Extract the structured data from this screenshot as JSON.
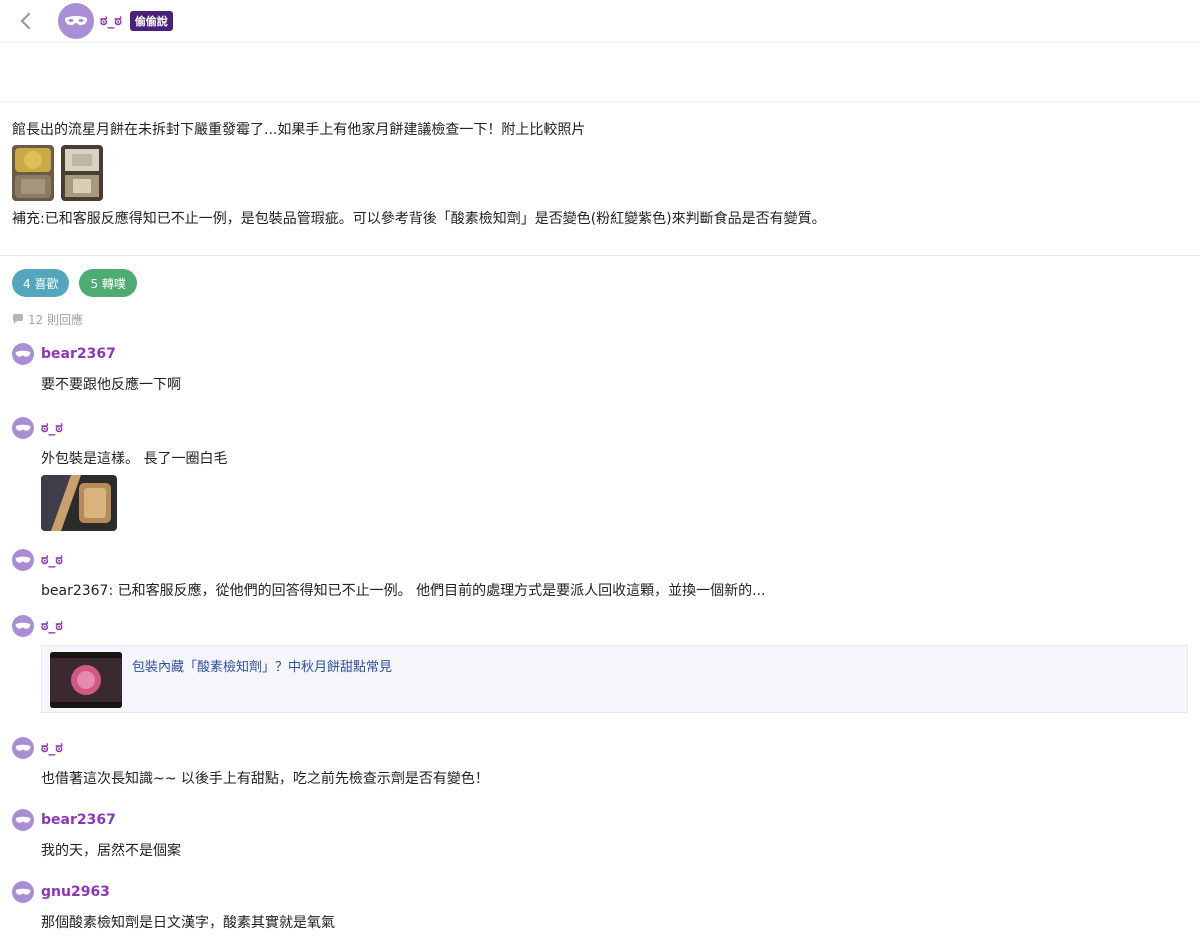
{
  "header": {
    "op_name": "ಠ_ಠ",
    "op_tag": "偷偷說"
  },
  "post": {
    "text": "館長出的流星月餅在未拆封下嚴重發霉了...如果手上有他家月餅建議檢查一下！附上比較照片",
    "supplement": "補充:已和客服反應得知已不止一例，是包裝品管瑕疵。可以參考背後「酸素檢知劑」是否變色(粉紅變紫色)來判斷食品是否有變質。"
  },
  "actions": {
    "like_label": "4 喜歡",
    "share_label": "5 轉噗",
    "reply_count": "12 則回應"
  },
  "comments": [
    {
      "user": "bear2367",
      "text": "要不要跟他反應一下啊"
    },
    {
      "user": "ಠ_ಠ",
      "text": "外包裝是這樣。 長了一圈白毛"
    },
    {
      "user": "ಠ_ಠ",
      "text": "bear2367: 已和客服反應，從他們的回答得知已不止一例。 他們目前的處理方式是要派人回收這顆，並換一個新的..."
    },
    {
      "user": "ಠ_ಠ",
      "link_title": "包裝內藏「酸素檢知劑」？中秋月餅甜點常見"
    },
    {
      "user": "ಠ_ಠ",
      "text": "也借著這次長知識~~ 以後手上有甜點，吃之前先檢查示劑是否有變色！"
    },
    {
      "user": "bear2367",
      "text": "我的天，居然不是個案"
    },
    {
      "user": "gnu2963",
      "text": "那個酸素檢知劑是日文漢字，酸素其實就是氧氣"
    }
  ],
  "colors": {
    "username": "#8d36b9",
    "avatar": "#a98ed6",
    "like_pill": "#54a6bf",
    "share_pill": "#4dab73",
    "link_title": "#2f4fa0"
  }
}
